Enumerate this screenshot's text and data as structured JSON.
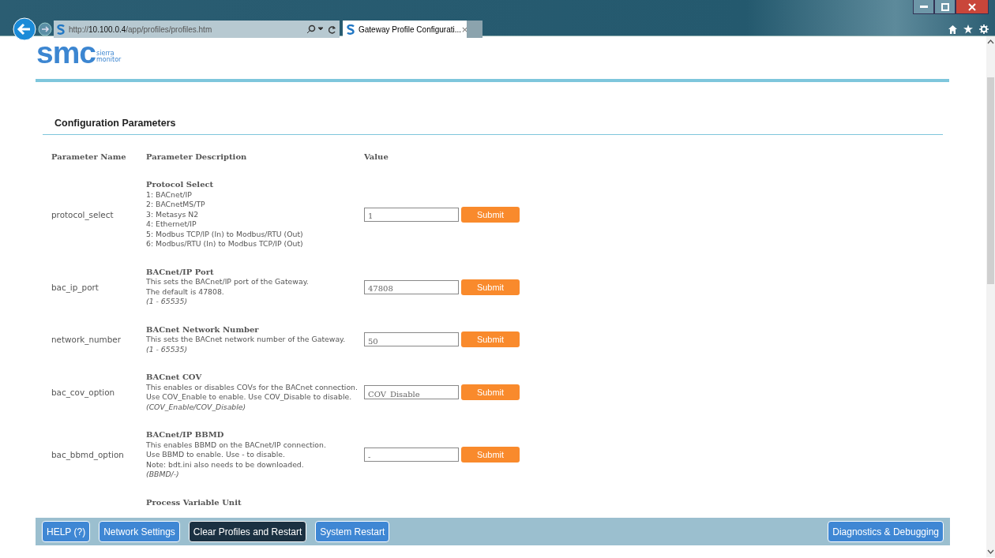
{
  "browser": {
    "url_prefix": "http://",
    "url_host": "10.100.0.4",
    "url_path": "/app/profiles/profiles.htm",
    "tab_title": "Gateway Profile Configurati...",
    "tab_close": "×"
  },
  "logo": {
    "mark": "smc",
    "line1": "sierra",
    "line2": "monitor"
  },
  "section_title": "Configuration Parameters",
  "columns": [
    "Parameter Name",
    "Parameter Description",
    "Value"
  ],
  "rows": [
    {
      "name": "protocol_select",
      "title": "Protocol Select",
      "lines": [
        "1: BACnet/IP",
        "2: BACnetMS/TP",
        "3: Metasys N2",
        "4: Ethernet/IP",
        "5: Modbus TCP/IP (In) to Modbus/RTU (Out)",
        "6: Modbus/RTU (In) to Modbus TCP/IP (Out)"
      ],
      "range": "",
      "value": "1",
      "button": "Submit"
    },
    {
      "name": "bac_ip_port",
      "title": "BACnet/IP Port",
      "lines": [
        "This sets the BACnet/IP port of the Gateway.",
        "The default is 47808."
      ],
      "range": "(1 - 65535)",
      "value": "47808",
      "button": "Submit"
    },
    {
      "name": "network_number",
      "title": "BACnet Network Number",
      "lines": [
        "This sets the BACnet network number of the Gateway."
      ],
      "range": "(1 - 65535)",
      "value": "50",
      "button": "Submit"
    },
    {
      "name": "bac_cov_option",
      "title": "BACnet COV",
      "lines": [
        "This enables or disables COVs for the BACnet connection.",
        "Use COV_Enable to enable. Use COV_Disable to disable."
      ],
      "range": "(COV_Enable/COV_Disable)",
      "value": "COV_Disable",
      "button": "Submit"
    },
    {
      "name": "bac_bbmd_option",
      "title": "BACnet/IP BBMD",
      "lines": [
        "This enables BBMD on the BACnet/IP connection.",
        "Use BBMD to enable. Use - to disable.",
        "Note: bdt.ini also needs to be downloaded."
      ],
      "range": "(BBMD/-)",
      "value": "-",
      "button": "Submit"
    },
    {
      "name": "",
      "title": "Process Variable Unit",
      "lines": [],
      "range": "",
      "value": "",
      "button": ""
    }
  ],
  "footer_buttons": [
    {
      "label": "HELP (?)",
      "selected": false
    },
    {
      "label": "Network Settings",
      "selected": false
    },
    {
      "label": "Clear Profiles and Restart",
      "selected": true
    },
    {
      "label": "System Restart",
      "selected": false
    }
  ],
  "footer_right_button": "Diagnostics & Debugging"
}
